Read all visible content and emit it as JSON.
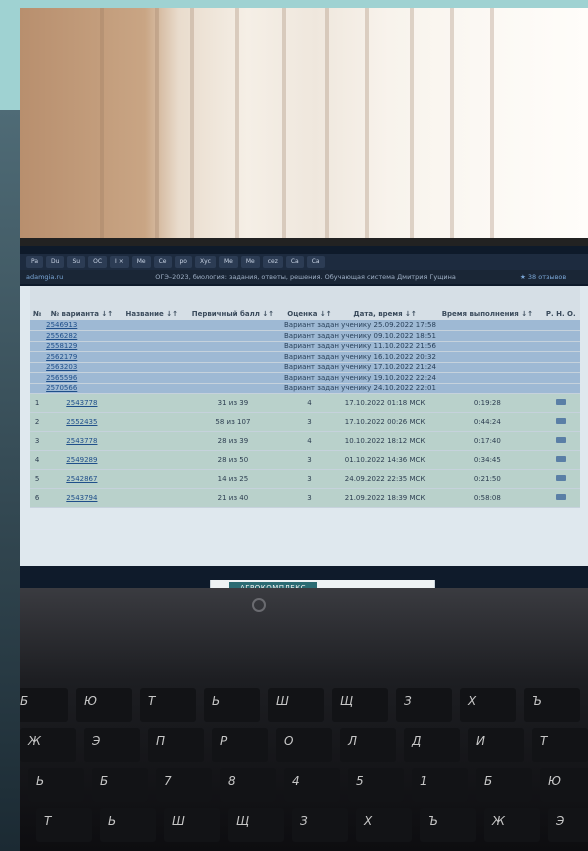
{
  "browser": {
    "tabs": [
      "Pa",
      "Du",
      "Su",
      "OC",
      "I ×",
      "Me",
      "Ce",
      "po",
      "Xyc",
      "Me",
      "Me",
      "cez",
      "Ca",
      "Ca"
    ],
    "site": "adamgia.ru",
    "title": "ОГЭ–2023, биология: задания, ответы, решения. Обучающая система Дмитрия Гущина",
    "reviews": "★ 38 отзывов"
  },
  "table": {
    "headers": [
      "№",
      "№ варианта ↓↑",
      "Название ↓↑",
      "Первичный балл ↓↑",
      "Оценка ↓↑",
      "Дата, время ↓↑",
      "Время выполнения ↓↑",
      "Р. Н. О."
    ],
    "assigned": [
      {
        "variant": "2546913",
        "note": "Вариант задан ученику 25.09.2022 17:58"
      },
      {
        "variant": "2556282",
        "note": "Вариант задан ученику 09.10.2022 18:51"
      },
      {
        "variant": "2558129",
        "note": "Вариант задан ученику 11.10.2022 21:56"
      },
      {
        "variant": "2562179",
        "note": "Вариант задан ученику 16.10.2022 20:32"
      },
      {
        "variant": "2563203",
        "note": "Вариант задан ученику 17.10.2022 21:24"
      },
      {
        "variant": "2565596",
        "note": "Вариант задан ученику 19.10.2022 22:24"
      },
      {
        "variant": "2570566",
        "note": "Вариант задан ученику 24.10.2022 22:01"
      }
    ],
    "done": [
      {
        "n": "1",
        "variant": "2543778",
        "score": "31 из 39",
        "grade": "4",
        "date": "17.10.2022 01:18 МСК",
        "duration": "0:19:28"
      },
      {
        "n": "2",
        "variant": "2552435",
        "score": "58 из 107",
        "grade": "3",
        "date": "17.10.2022 00:26 МСК",
        "duration": "0:44:24"
      },
      {
        "n": "3",
        "variant": "2543778",
        "score": "28 из 39",
        "grade": "4",
        "date": "10.10.2022 18:12 МСК",
        "duration": "0:17:40"
      },
      {
        "n": "4",
        "variant": "2549289",
        "score": "28 из 50",
        "grade": "3",
        "date": "01.10.2022 14:36 МСК",
        "duration": "0:34:45"
      },
      {
        "n": "5",
        "variant": "2542867",
        "score": "14 из 25",
        "grade": "3",
        "date": "24.09.2022 22:35 МСК",
        "duration": "0:21:50"
      },
      {
        "n": "6",
        "variant": "2543794",
        "score": "21 из 40",
        "grade": "3",
        "date": "21.09.2022 18:39 МСК",
        "duration": "0:58:08"
      }
    ]
  },
  "ad": {
    "label": "АГРОКОМПЛЕКС"
  },
  "keyboard": {
    "keys": [
      "Б",
      "Ю",
      "Т",
      "Ь",
      "Ш",
      "Щ",
      "З",
      "Х",
      "Ъ",
      "Ж",
      "Э",
      "П",
      "Р",
      "О",
      "Л",
      "Д",
      "И",
      "Т",
      "Ь",
      "Б",
      "7",
      "8",
      "4",
      "5",
      "1"
    ]
  }
}
